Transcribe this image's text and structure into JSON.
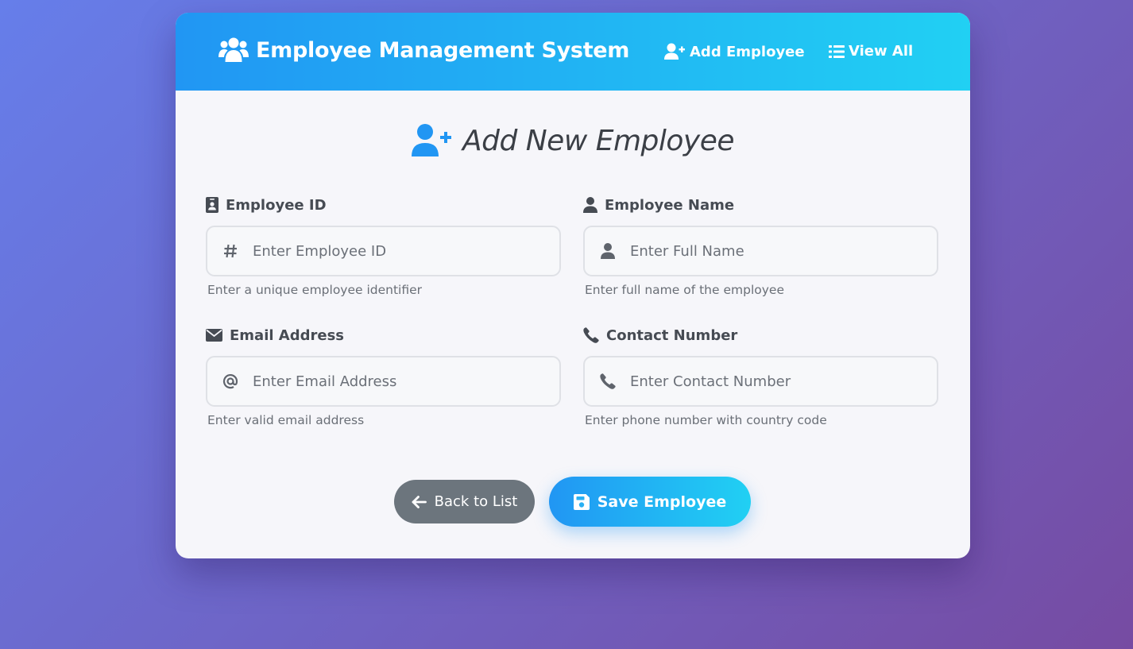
{
  "header": {
    "title": "Employee Management System",
    "brand_icon": "users-icon",
    "nav": {
      "add_label": "Add Employee",
      "add_icon": "user-plus-icon",
      "view_label": "View All",
      "view_icon": "list-icon"
    }
  },
  "form": {
    "heading": "Add New Employee",
    "heading_icon": "user-plus-icon",
    "fields": [
      {
        "label": "Employee ID",
        "label_icon": "id-badge-icon",
        "input_icon": "hash-icon",
        "placeholder": "Enter Employee ID",
        "value": "",
        "help": "Enter a unique employee identifier"
      },
      {
        "label": "Employee Name",
        "label_icon": "user-icon",
        "input_icon": "user-icon",
        "placeholder": "Enter Full Name",
        "value": "",
        "help": "Enter full name of the employee"
      },
      {
        "label": "Email Address",
        "label_icon": "envelope-icon",
        "input_icon": "at-icon",
        "placeholder": "Enter Email Address",
        "value": "",
        "help": "Enter valid email address"
      },
      {
        "label": "Contact Number",
        "label_icon": "phone-icon",
        "input_icon": "phone-icon",
        "placeholder": "Enter Contact Number",
        "value": "",
        "help": "Enter phone number with country code"
      }
    ],
    "buttons": {
      "back_label": "Back to List",
      "back_icon": "arrow-left-icon",
      "save_label": "Save Employee",
      "save_icon": "floppy-disk-icon"
    }
  },
  "colors": {
    "background_start": "#667eea",
    "background_end": "#764ba2",
    "primary_start": "#2196f3",
    "primary_end": "#21d0f3",
    "secondary_button": "#6c757d"
  }
}
